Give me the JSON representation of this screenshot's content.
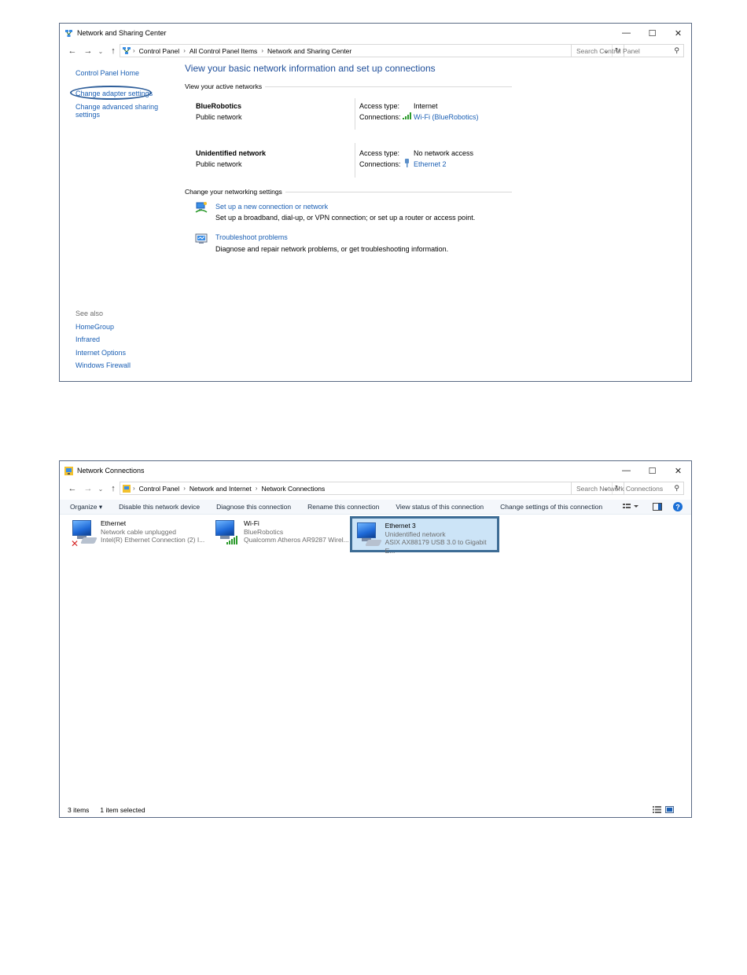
{
  "window1": {
    "title": "Network and Sharing Center",
    "controls": {
      "minimize": "—",
      "maximize": "☐",
      "close": "✕"
    },
    "breadcrumb": [
      "Control Panel",
      "All Control Panel Items",
      "Network and Sharing Center"
    ],
    "search_placeholder": "Search Control Panel",
    "sidebar": {
      "home": "Control Panel Home",
      "change_adapter": "Change adapter settings",
      "change_advanced_line1": "Change advanced sharing",
      "change_advanced_line2": "settings",
      "see_also": "See also",
      "links": [
        "HomeGroup",
        "Infrared",
        "Internet Options",
        "Windows Firewall"
      ]
    },
    "main": {
      "heading": "View your basic network information and set up connections",
      "active_networks_label": "View your active networks",
      "networks": [
        {
          "name": "BlueRobotics",
          "category": "Public network",
          "access_label": "Access type:",
          "access_value": "Internet",
          "connections_label": "Connections:",
          "connection": "Wi-Fi (BlueRobotics)"
        },
        {
          "name": "Unidentified network",
          "category": "Public network",
          "access_label": "Access type:",
          "access_value": "No network access",
          "connections_label": "Connections:",
          "connection": "Ethernet 2"
        }
      ],
      "change_settings_label": "Change your networking settings",
      "tasks": [
        {
          "title": "Set up a new connection or network",
          "desc": "Set up a broadband, dial-up, or VPN connection; or set up a router or access point."
        },
        {
          "title": "Troubleshoot problems",
          "desc": "Diagnose and repair network problems, or get troubleshooting information."
        }
      ]
    }
  },
  "window2": {
    "title": "Network Connections",
    "controls": {
      "minimize": "—",
      "maximize": "☐",
      "close": "✕"
    },
    "breadcrumb": [
      "Control Panel",
      "Network and Internet",
      "Network Connections"
    ],
    "search_placeholder": "Search Network Connections",
    "toolbar": {
      "organize": "Organize ▾",
      "disable": "Disable this network device",
      "diagnose": "Diagnose this connection",
      "rename": "Rename this connection",
      "view_status": "View status of this connection",
      "change_settings": "Change settings of this connection"
    },
    "adapters": [
      {
        "name": "Ethernet",
        "status": "Network cable unplugged",
        "device": "Intel(R) Ethernet Connection (2) I..."
      },
      {
        "name": "Wi-Fi",
        "status": "BlueRobotics",
        "device": "Qualcomm Atheros AR9287 Wirel..."
      },
      {
        "name": "Ethernet 3",
        "status": "Unidentified network",
        "device": "ASIX AX88179 USB 3.0 to Gigabit E..."
      }
    ],
    "status_bar": {
      "items": "3 items",
      "selected": "1 item selected"
    }
  },
  "colors": {
    "link": "#1a5fb4",
    "heading": "#1e4e9a",
    "selection": "#cce4f7",
    "selection_border": "#3d6c95"
  }
}
